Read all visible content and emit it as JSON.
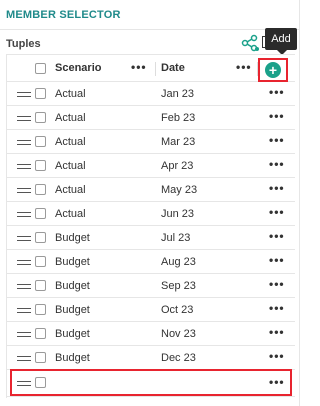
{
  "panel": {
    "title": "MEMBER SELECTOR"
  },
  "tuples": {
    "label": "Tuples",
    "tooltip": "Add"
  },
  "grid": {
    "columns": [
      {
        "label": "Scenario",
        "menu": "•••"
      },
      {
        "label": "Date",
        "menu": "•••"
      }
    ],
    "add_symbol": "+",
    "row_menu": "•••",
    "rows": [
      {
        "scenario": "Actual",
        "date": "Jan 23"
      },
      {
        "scenario": "Actual",
        "date": "Feb 23"
      },
      {
        "scenario": "Actual",
        "date": "Mar 23"
      },
      {
        "scenario": "Actual",
        "date": "Apr 23"
      },
      {
        "scenario": "Actual",
        "date": "May 23"
      },
      {
        "scenario": "Actual",
        "date": "Jun 23"
      },
      {
        "scenario": "Budget",
        "date": "Jul 23"
      },
      {
        "scenario": "Budget",
        "date": "Aug 23"
      },
      {
        "scenario": "Budget",
        "date": "Sep 23"
      },
      {
        "scenario": "Budget",
        "date": "Oct 23"
      },
      {
        "scenario": "Budget",
        "date": "Nov 23"
      },
      {
        "scenario": "Budget",
        "date": "Dec 23"
      }
    ],
    "new_row": {
      "scenario": "",
      "date": ""
    }
  },
  "colors": {
    "accent": "#1f8a8a",
    "add": "#1aa18a",
    "highlight": "#e8242f"
  },
  "icons": [
    "share-icon",
    "table-icon",
    "add-icon",
    "drag-handle-icon"
  ]
}
